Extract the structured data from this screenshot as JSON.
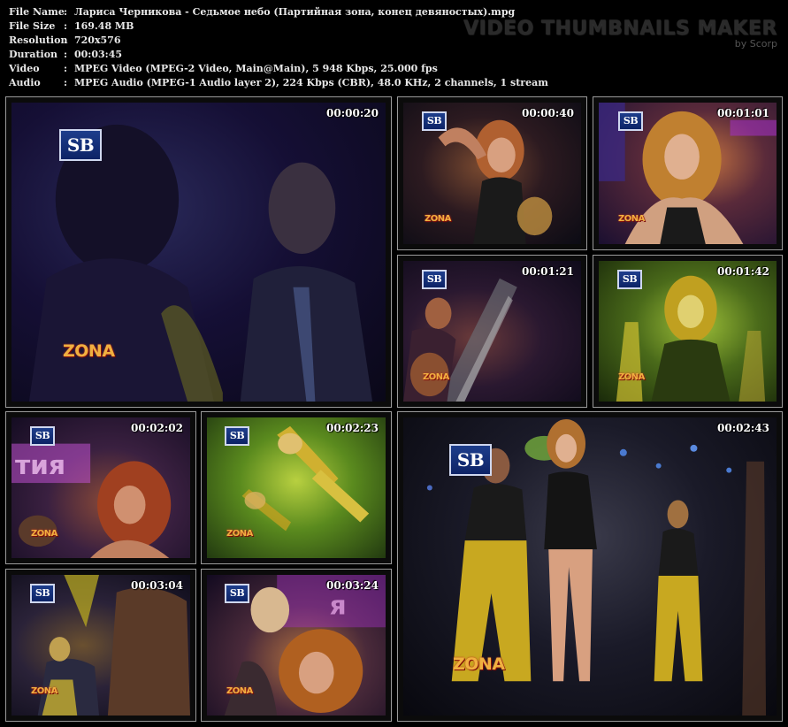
{
  "info": {
    "rows": [
      {
        "key": "File Name",
        "value": "Лариса Черникова - Седьмое небо (Партийная зона, конец девяностых).mpg"
      },
      {
        "key": "File Size",
        "value": "169.48 MB"
      },
      {
        "key": "Resolution",
        "value": "720x576"
      },
      {
        "key": "Duration",
        "value": "00:03:45"
      },
      {
        "key": "Video",
        "value": "MPEG Video (MPEG-2 Video, Main@Main), 5 948 Kbps, 25.000 fps"
      },
      {
        "key": "Audio",
        "value": "MPEG Audio (MPEG-1 Audio layer 2), 224 Kbps (CBR), 48.0 KHz, 2 channels, 1 stream"
      }
    ],
    "separator": ":"
  },
  "brand": {
    "title": "VIDEO THUMBNAILS MAKER",
    "subtitle": "by Scorp"
  },
  "overlay": {
    "channel_logo": "SB",
    "show_logo": "ZONA"
  },
  "thumbnails": [
    {
      "time": "00:00:20"
    },
    {
      "time": "00:00:40"
    },
    {
      "time": "00:01:01"
    },
    {
      "time": "00:01:21"
    },
    {
      "time": "00:01:42"
    },
    {
      "time": "00:02:02"
    },
    {
      "time": "00:02:23"
    },
    {
      "time": "00:02:43"
    },
    {
      "time": "00:03:04"
    },
    {
      "time": "00:03:24"
    }
  ]
}
